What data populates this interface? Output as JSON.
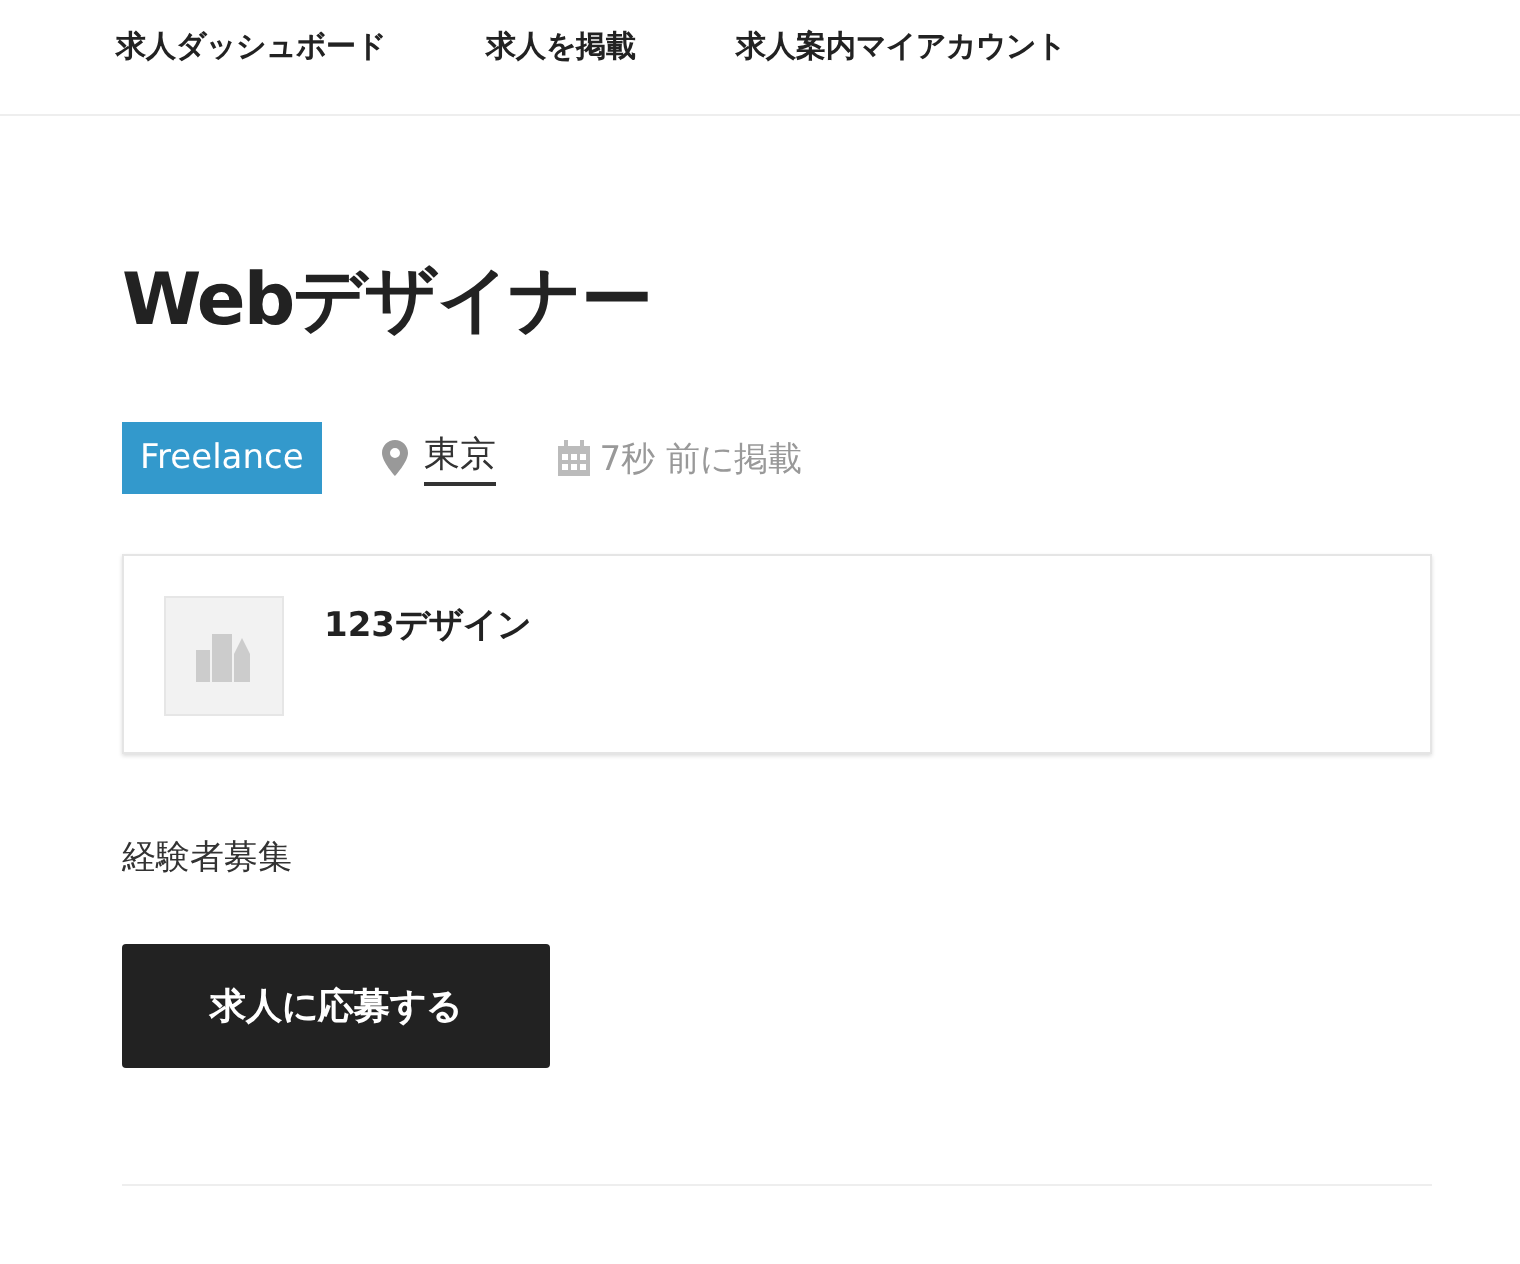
{
  "nav": [
    {
      "label": "求人ダッシュボード"
    },
    {
      "label": "求人を掲載"
    },
    {
      "label": "求人案内マイアカウント"
    }
  ],
  "job": {
    "title": "Webデザイナー",
    "type": "Freelance",
    "location": "東京",
    "posted": "7秒 前に掲載"
  },
  "company": {
    "name": "123デザイン"
  },
  "description": "経験者募集",
  "apply_button": "求人に応募する"
}
